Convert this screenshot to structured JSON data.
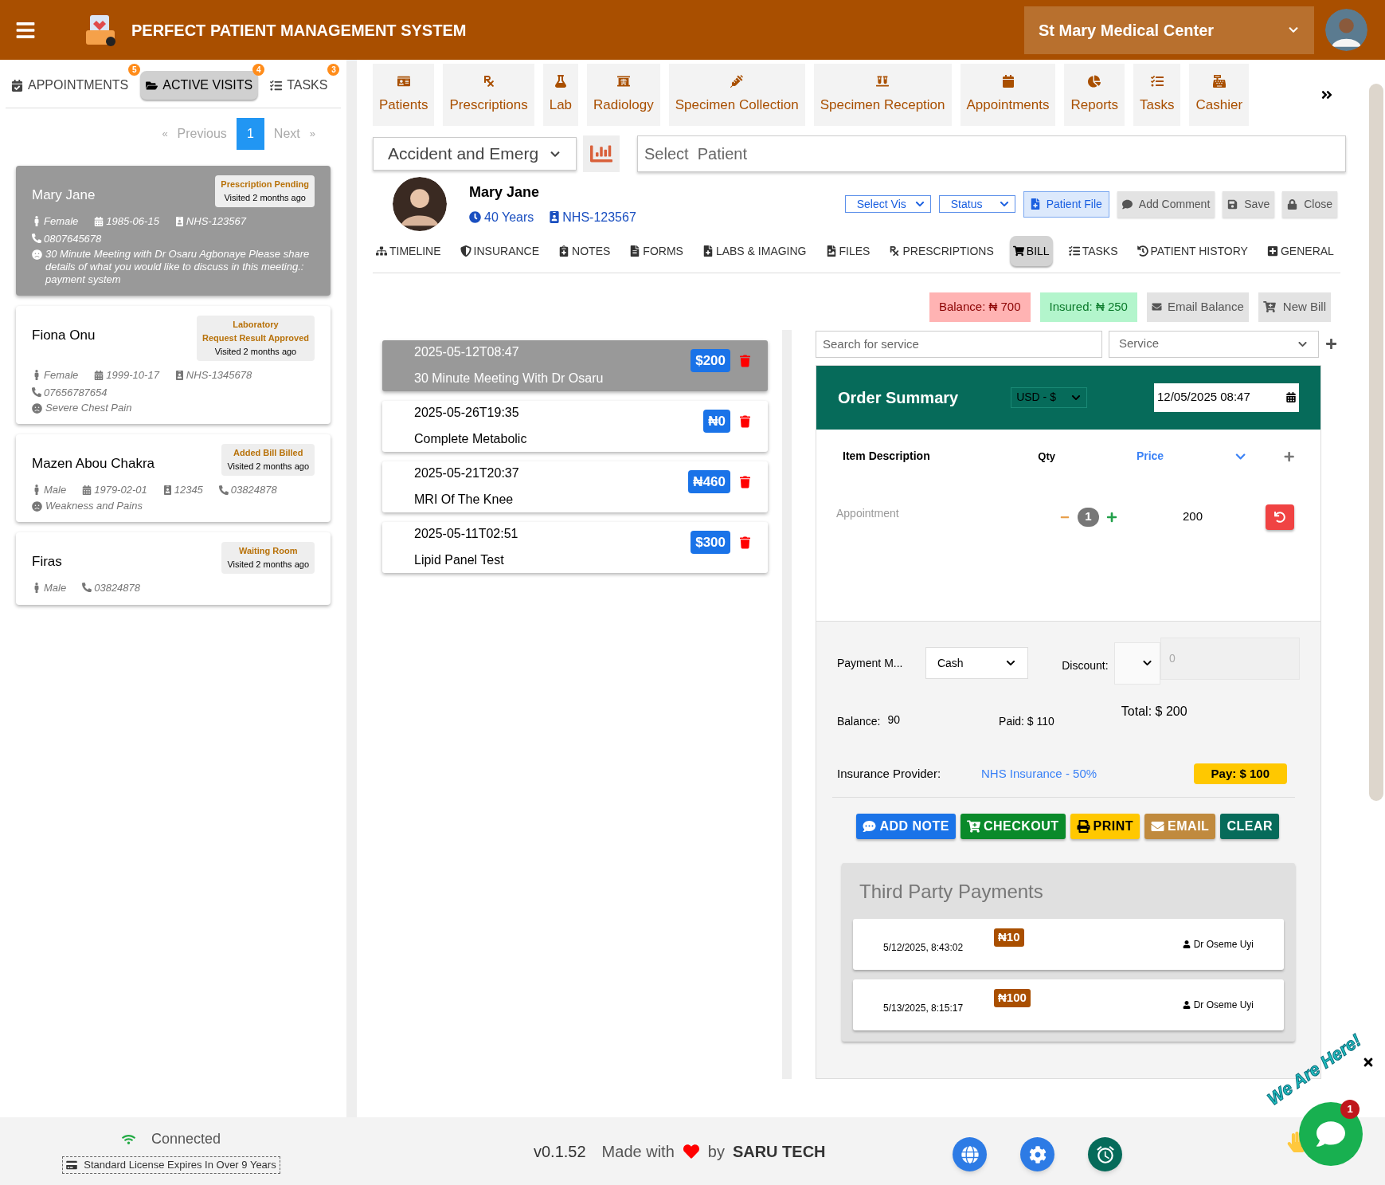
{
  "header": {
    "title": "PERFECT PATIENT MANAGEMENT SYSTEM",
    "facility": "St Mary Medical Center"
  },
  "left_tabs": [
    {
      "label": "APPOINTMENTS",
      "count": "5",
      "selected": false
    },
    {
      "label": "ACTIVE VISITS",
      "count": "4",
      "selected": true
    },
    {
      "label": "TASKS",
      "count": "3",
      "selected": false
    }
  ],
  "pagination": {
    "previous": "Previous",
    "pages": [
      {
        "label": "1",
        "selected": true
      }
    ],
    "next": "Next",
    "prev_arrow": "«",
    "next_arrow": "»"
  },
  "visit_cards": [
    {
      "name": "Mary Jane",
      "status": [
        "Prescription Pending"
      ],
      "visited": "Visited 2 months ago",
      "selected": true,
      "gender": "Female",
      "dob": "1985-06-15",
      "id": "NHS-123567",
      "phone": "0807645678",
      "note": "30 Minute Meeting with Dr Osaru Agbonaye Please share details of what you would like to discuss in this meeting.: payment system"
    },
    {
      "name": "Fiona Onu",
      "status": [
        "Laboratory",
        "Request Result Approved"
      ],
      "visited": "Visited 2 months ago",
      "selected": false,
      "gender": "Female",
      "dob": "1999-10-17",
      "id": "NHS-1345678",
      "phone": "07656787654",
      "note": "Severe Chest Pain"
    },
    {
      "name": "Mazen Abou Chakra",
      "status": [
        "Added Bill Billed"
      ],
      "visited": "Visited 2 months ago",
      "selected": false,
      "gender": "Male",
      "dob": "1979-02-01",
      "id": "12345",
      "phone": "03824878",
      "note": "Weakness and Pains"
    },
    {
      "name": "Firas",
      "status": [
        "Waiting Room"
      ],
      "visited": "Visited 2 months ago",
      "selected": false,
      "gender": "Male",
      "phone": "03824878"
    }
  ],
  "nav_tiles": [
    "Patients",
    "Prescriptions",
    "Lab",
    "Radiology",
    "Specimen Collection",
    "Specimen Reception",
    "Appointments",
    "Reports",
    "Tasks",
    "Cashier"
  ],
  "department": {
    "value": "Accident and Emerg"
  },
  "patient_search": {
    "placeholder": "Select  Patient"
  },
  "patient": {
    "name": "Mary Jane",
    "age": "40 Years",
    "id": "NHS-123567"
  },
  "patient_actions": [
    {
      "kind": "select",
      "label": "Select Vis"
    },
    {
      "kind": "select",
      "label": "Status"
    },
    {
      "kind": "primary",
      "label": "Patient File"
    },
    {
      "kind": "plain",
      "label": "Add Comment"
    },
    {
      "kind": "plain",
      "label": "Save"
    },
    {
      "kind": "plain",
      "label": "Close"
    }
  ],
  "patient_tabs": [
    {
      "label": "TIMELINE",
      "selected": false
    },
    {
      "label": "INSURANCE",
      "selected": false
    },
    {
      "label": "NOTES",
      "selected": false
    },
    {
      "label": "FORMS",
      "selected": false
    },
    {
      "label": "LABS & IMAGING",
      "selected": false
    },
    {
      "label": "FILES",
      "selected": false
    },
    {
      "label": "PRESCRIPTIONS",
      "selected": false
    },
    {
      "label": "BILL",
      "selected": true
    },
    {
      "label": "TASKS",
      "selected": false
    },
    {
      "label": "PATIENT HISTORY",
      "selected": false
    },
    {
      "label": "GENERAL",
      "selected": false
    }
  ],
  "summary": {
    "balance": "Balance: ₦ 700",
    "insured": "Insured: ₦ 250",
    "email_balance": "Email Balance",
    "new_bill": "New Bill"
  },
  "bills": [
    {
      "date": "2025-05-12T08:47",
      "title": "30 Minute Meeting With Dr Osaru",
      "amount": "$200",
      "selected": true
    },
    {
      "date": "2025-05-26T19:35",
      "title": "Complete Metabolic",
      "amount": "₦0",
      "selected": false
    },
    {
      "date": "2025-05-21T20:37",
      "title": "MRI Of The Knee",
      "amount": "₦460",
      "selected": false
    },
    {
      "date": "2025-05-11T02:51",
      "title": "Lipid Panel Test",
      "amount": "$300",
      "selected": false
    }
  ],
  "service_search": {
    "placeholder": "Search for service"
  },
  "service_select": {
    "placeholder": "Service"
  },
  "order": {
    "title": "Order Summary",
    "currency": "USD - $",
    "date": "12/05/2025 08:47",
    "columns": [
      "Item Description",
      "Qty",
      "Price"
    ],
    "items": [
      {
        "description": "Appointment",
        "qty": "1",
        "price": "200"
      }
    ],
    "payment_label": "Payment M...",
    "payment_value": "Cash",
    "discount_label": "Discount:",
    "discount_placeholder": "0",
    "balance_label": "Balance:",
    "balance_value": "90",
    "paid": "Paid: $ 110",
    "total": "Total: $ 200",
    "insurance_label": "Insurance Provider:",
    "insurance_value": "NHS Insurance - 50%",
    "pay": "Pay: $ 100",
    "actions": [
      {
        "label": "ADD NOTE",
        "color": "#1a73e8"
      },
      {
        "label": "CHECKOUT",
        "color": "#0a8a2a"
      },
      {
        "label": "PRINT",
        "color": "#ffc800"
      },
      {
        "label": "EMAIL",
        "color": "#c08a3e"
      },
      {
        "label": "CLEAR",
        "color": "#066b5a"
      }
    ]
  },
  "third_party": {
    "title": "Third Party Payments",
    "items": [
      {
        "date": "5/12/2025, 8:43:02",
        "amount": "₦10",
        "person": "Dr Oseme Uyi"
      },
      {
        "date": "5/13/2025, 8:15:17",
        "amount": "₦100",
        "person": "Dr Oseme Uyi"
      }
    ]
  },
  "footer": {
    "status": "Connected",
    "license": "Standard License Expires In Over 9 Years",
    "version": "v0.1.52",
    "made_with": "Made with",
    "by": "by",
    "company": "SARU TECH"
  },
  "chat": {
    "tagline": "We Are Here!",
    "badge": "1"
  }
}
